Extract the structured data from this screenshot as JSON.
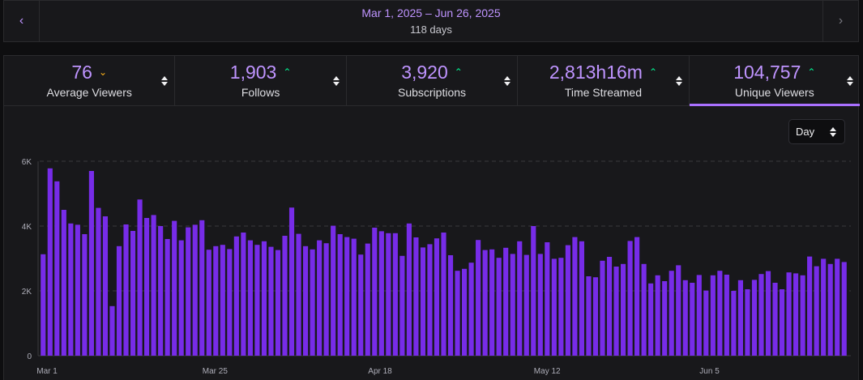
{
  "date_range": {
    "label": "Mar 1, 2025 – Jun 26, 2025",
    "days": "118 days"
  },
  "tabs": [
    {
      "value": "76",
      "label": "Average Viewers",
      "trend": "down",
      "active": false
    },
    {
      "value": "1,903",
      "label": "Follows",
      "trend": "up",
      "active": false
    },
    {
      "value": "3,920",
      "label": "Subscriptions",
      "trend": "up",
      "active": false
    },
    {
      "value": "2,813h16m",
      "label": "Time Streamed",
      "trend": "up",
      "active": false
    },
    {
      "value": "104,757",
      "label": "Unique Viewers",
      "trend": "up",
      "active": true
    }
  ],
  "granularity": {
    "selected": "Day"
  },
  "colors": {
    "accent": "#a970ff",
    "bar": "#772ce8",
    "trend_up": "#00f593",
    "trend_down": "#ffb31a"
  },
  "chart_data": {
    "type": "bar",
    "title": "",
    "xlabel": "",
    "ylabel": "",
    "ylim": [
      0,
      6000
    ],
    "y_ticks": [
      "0",
      "2K",
      "4K",
      "6K"
    ],
    "y_tick_values": [
      0,
      2000,
      4000,
      6000
    ],
    "x_tick_labels": [
      {
        "label": "Mar 1",
        "index": 0
      },
      {
        "label": "Mar 25",
        "index": 24
      },
      {
        "label": "Apr 18",
        "index": 48
      },
      {
        "label": "May 12",
        "index": 72
      },
      {
        "label": "Jun 5",
        "index": 96
      }
    ],
    "grid": true,
    "series": [
      {
        "values": [
          3130,
          5780,
          5380,
          4500,
          4080,
          4040,
          3750,
          5700,
          4560,
          4300,
          1530,
          3380,
          4050,
          3850,
          4820,
          4250,
          4340,
          4000,
          3600,
          4160,
          3560,
          3960,
          4040,
          4180,
          3270,
          3380,
          3420,
          3290,
          3680,
          3800,
          3560,
          3420,
          3530,
          3360,
          3260,
          3700,
          4570,
          3760,
          3380,
          3280,
          3560,
          3470,
          4010,
          3750,
          3660,
          3610,
          3120,
          3460,
          3950,
          3840,
          3780,
          3780,
          3080,
          4080,
          3650,
          3340,
          3440,
          3620,
          3800,
          3100,
          2620,
          2680,
          2870,
          3570,
          3260,
          3280,
          3020,
          3330,
          3140,
          3530,
          3110,
          4000,
          3140,
          3500,
          2990,
          3020,
          3410,
          3660,
          3530,
          2450,
          2420,
          2930,
          3050,
          2750,
          2830,
          3540,
          3660,
          2830,
          2230,
          2480,
          2300,
          2620,
          2790,
          2330,
          2250,
          2490,
          2010,
          2480,
          2620,
          2500,
          2000,
          2330,
          2050,
          2340,
          2520,
          2610,
          2250,
          2050,
          2570,
          2540,
          2480,
          3060,
          2760,
          2990,
          2830,
          2990,
          2890
        ]
      }
    ]
  }
}
